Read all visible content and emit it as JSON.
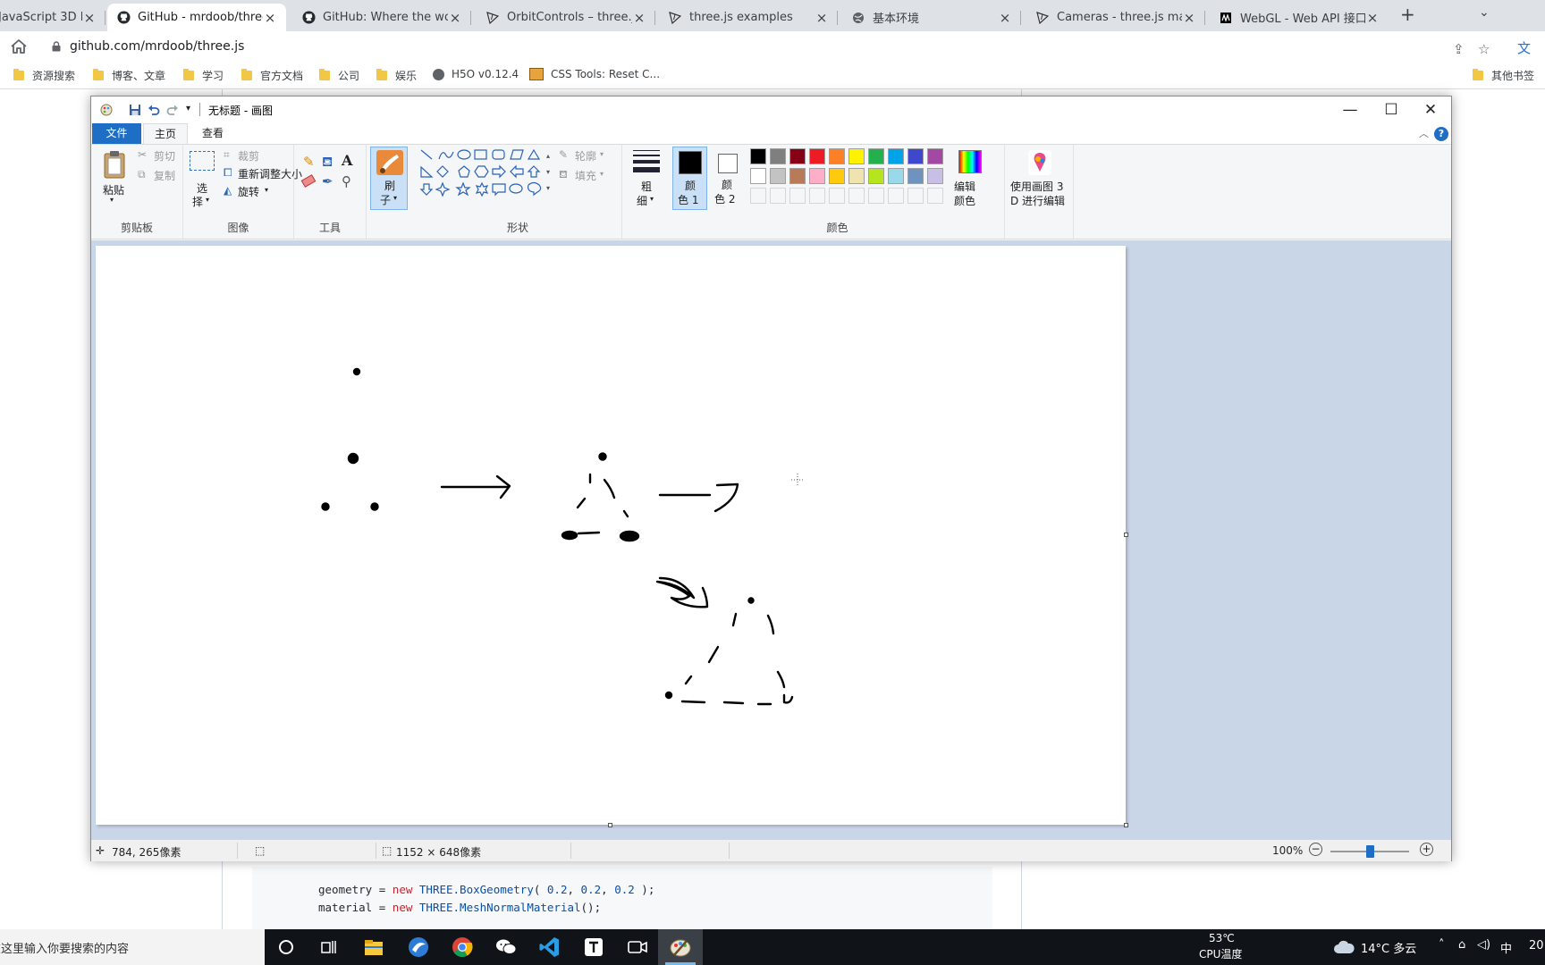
{
  "browser": {
    "tabs": [
      {
        "title": "JavaScript 3D l",
        "icon": "doc-icon",
        "active": false
      },
      {
        "title": "GitHub - mrdoob/three.j",
        "icon": "github-icon",
        "active": true
      },
      {
        "title": "GitHub: Where the world",
        "icon": "github-icon",
        "active": false
      },
      {
        "title": "OrbitControls – three.js d",
        "icon": "threejs-icon",
        "active": false
      },
      {
        "title": "three.js examples",
        "icon": "threejs-icon",
        "active": false
      },
      {
        "title": "基本环境",
        "icon": "globe-icon",
        "active": false
      },
      {
        "title": "Cameras - three.js manu",
        "icon": "threejs-icon",
        "active": false
      },
      {
        "title": "WebGL - Web API 接口参",
        "icon": "mdn-icon",
        "active": false
      }
    ],
    "url": "github.com/mrdoob/three.js",
    "bookmarks": [
      {
        "label": "资源搜索",
        "icon": "folder-icon"
      },
      {
        "label": "博客、文章",
        "icon": "folder-icon"
      },
      {
        "label": "学习",
        "icon": "folder-icon"
      },
      {
        "label": "官方文档",
        "icon": "folder-icon"
      },
      {
        "label": "公司",
        "icon": "folder-icon"
      },
      {
        "label": "娱乐",
        "icon": "folder-icon"
      },
      {
        "label": "H5O v0.12.4",
        "icon": "globe-icon"
      },
      {
        "label": "CSS Tools: Reset C...",
        "icon": "css-icon"
      }
    ],
    "other_bookmarks": "其他书签"
  },
  "background_page": {
    "code_lines": [
      {
        "parts": [
          [
            "",
            "geometry = "
          ],
          [
            "kw",
            "new"
          ],
          [
            "",
            " "
          ],
          [
            "cls",
            "THREE.BoxGeometry"
          ],
          [
            "",
            "( "
          ],
          [
            "num",
            "0.2"
          ],
          [
            "",
            ", "
          ],
          [
            "num",
            "0.2"
          ],
          [
            "",
            ", "
          ],
          [
            "num",
            "0.2"
          ],
          [
            "",
            " );"
          ]
        ]
      },
      {
        "parts": [
          [
            "",
            "material = "
          ],
          [
            "kw",
            "new"
          ],
          [
            "",
            " "
          ],
          [
            "cls",
            "THREE.MeshNormalMaterial"
          ],
          [
            "",
            "();"
          ]
        ]
      }
    ]
  },
  "paint": {
    "title": "无标题 - 画图",
    "tabs": {
      "file": "文件",
      "home": "主页",
      "view": "查看"
    },
    "clipboard": {
      "paste": "粘贴",
      "cut": "剪切",
      "copy": "复制",
      "group": "剪贴板"
    },
    "image": {
      "select_1": "选",
      "select_2": "择",
      "crop": "裁剪",
      "resize": "重新调整大小",
      "rotate": "旋转",
      "group": "图像"
    },
    "tools": {
      "group": "工具"
    },
    "brush": {
      "line1": "刷",
      "line2": "子"
    },
    "shapes": {
      "outline": "轮廓",
      "fill": "填充",
      "group": "形状"
    },
    "size": {
      "line1": "粗",
      "line2": "细"
    },
    "colors": {
      "color1_l1": "颜",
      "color1_l2": "色 1",
      "color2_l1": "颜",
      "color2_l2": "色 2",
      "edit_l1": "编辑",
      "edit_l2": "颜色",
      "group": "颜色",
      "color1": "#000000",
      "color2": "#ffffff",
      "palette_row1": [
        "#000000",
        "#7f7f7f",
        "#880015",
        "#ed1c24",
        "#ff7f27",
        "#fff200",
        "#22b14c",
        "#00a2e8",
        "#3f48cc",
        "#a349a4"
      ],
      "palette_row2": [
        "#ffffff",
        "#c3c3c3",
        "#b97a57",
        "#ffaec9",
        "#ffc90e",
        "#efe4b0",
        "#b5e61d",
        "#99d9ea",
        "#7092be",
        "#c8bfe7"
      ]
    },
    "paint3d": {
      "line1": "使用画图 3",
      "line2": "D 进行编辑"
    },
    "status": {
      "cursor": "784, 265像素",
      "size": "1152 × 648像素",
      "zoom": "100%",
      "zoom_level": 0.5
    }
  },
  "taskbar": {
    "search_placeholder": "在这里输入你要搜索的内容",
    "cpu_temp": "53℃",
    "cpu_label": "CPU温度",
    "weather": "14°C 多云",
    "ime": "中",
    "clock_partial": "20"
  }
}
